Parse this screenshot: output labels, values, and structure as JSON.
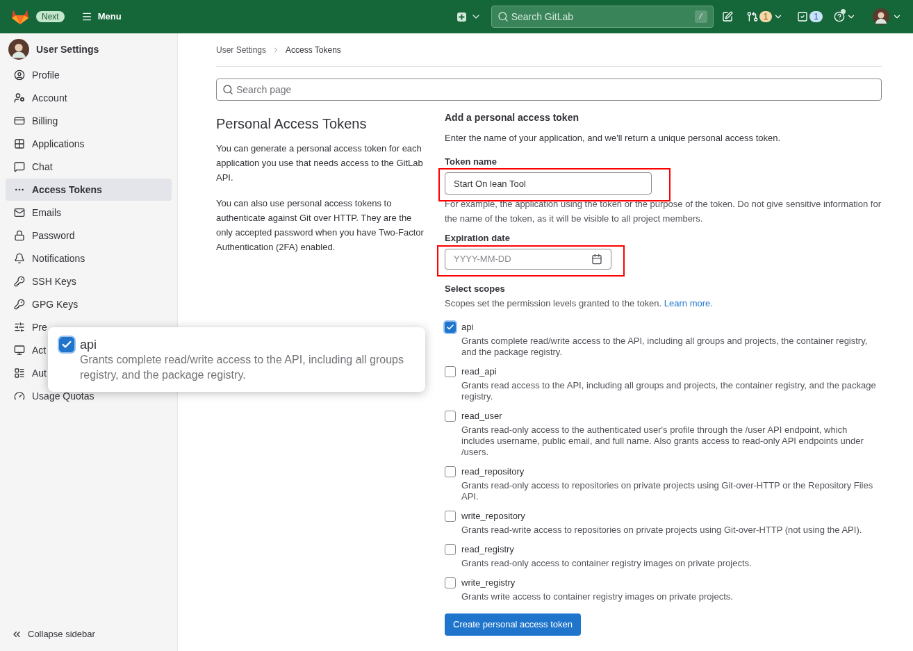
{
  "header": {
    "badge": "Next",
    "menu": "Menu",
    "search": {
      "placeholder": "Search GitLab",
      "shortcut": "/"
    },
    "merge_requests_count": "1",
    "todos_count": "1"
  },
  "sidebar": {
    "title": "User Settings",
    "items": [
      {
        "label": "Profile",
        "selected": false
      },
      {
        "label": "Account",
        "selected": false
      },
      {
        "label": "Billing",
        "selected": false
      },
      {
        "label": "Applications",
        "selected": false
      },
      {
        "label": "Chat",
        "selected": false
      },
      {
        "label": "Access Tokens",
        "selected": true
      },
      {
        "label": "Emails",
        "selected": false
      },
      {
        "label": "Password",
        "selected": false
      },
      {
        "label": "Notifications",
        "selected": false
      },
      {
        "label": "SSH Keys",
        "selected": false
      },
      {
        "label": "GPG Keys",
        "selected": false
      },
      {
        "label": "Pre",
        "selected": false
      },
      {
        "label": "Act",
        "selected": false
      },
      {
        "label": "Aut",
        "selected": false
      },
      {
        "label": "Usage Quotas",
        "selected": false
      }
    ],
    "collapse": "Collapse sidebar"
  },
  "breadcrumb": [
    "User Settings",
    "Access Tokens"
  ],
  "search_page": {
    "placeholder": "Search page"
  },
  "intro": {
    "title": "Personal Access Tokens",
    "paragraphs": [
      "You can generate a personal access token for each application you use that needs access to the GitLab API.",
      "You can also use personal access tokens to authenticate against Git over HTTP. They are the only accepted password when you have Two-Factor Authentication (2FA) enabled."
    ]
  },
  "form": {
    "heading": "Add a personal access token",
    "description": "Enter the name of your application, and we'll return a unique personal access token.",
    "token_name": {
      "label": "Token name",
      "value": "Start On lean Tool",
      "help": "For example, the application using the token or the purpose of the token. Do not give sensitive information for the name of the token, as it will be visible to all project members."
    },
    "expiration": {
      "label": "Expiration date",
      "placeholder": "YYYY-MM-DD"
    },
    "scopes": {
      "label": "Select scopes",
      "description": "Scopes set the permission levels granted to the token.",
      "link": "Learn more.",
      "items": [
        {
          "name": "api",
          "checked": true,
          "description": "Grants complete read/write access to the API, including all groups and projects, the container registry, and the package registry."
        },
        {
          "name": "read_api",
          "checked": false,
          "description": "Grants read access to the API, including all groups and projects, the container registry, and the package registry."
        },
        {
          "name": "read_user",
          "checked": false,
          "description": "Grants read-only access to the authenticated user's profile through the /user API endpoint, which includes username, public email, and full name. Also grants access to read-only API endpoints under /users."
        },
        {
          "name": "read_repository",
          "checked": false,
          "description": "Grants read-only access to repositories on private projects using Git-over-HTTP or the Repository Files API."
        },
        {
          "name": "write_repository",
          "checked": false,
          "description": "Grants read-write access to repositories on private projects using Git-over-HTTP (not using the API)."
        },
        {
          "name": "read_registry",
          "checked": false,
          "description": "Grants read-only access to container registry images on private projects."
        },
        {
          "name": "write_registry",
          "checked": false,
          "description": "Grants write access to container registry images on private projects."
        }
      ]
    },
    "submit": "Create personal access token"
  },
  "callout": {
    "name": "api",
    "checked": true,
    "lines": [
      "Grants complete read/write access to the API, including all groups",
      "registry, and the package registry."
    ]
  }
}
